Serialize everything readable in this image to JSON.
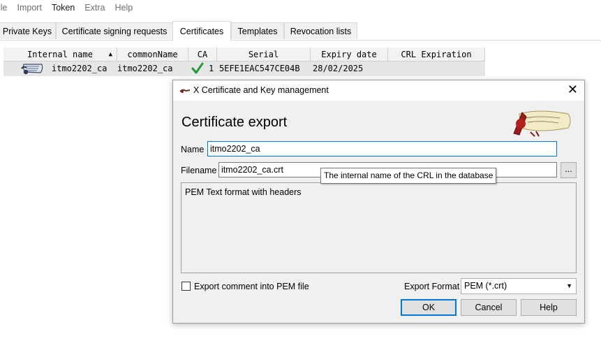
{
  "menu": {
    "file": "ile",
    "import": "Import",
    "token": "Token",
    "extra": "Extra",
    "help": "Help"
  },
  "tabs": [
    "Private Keys",
    "Certificate signing requests",
    "Certificates",
    "Templates",
    "Revocation lists"
  ],
  "list": {
    "headers": [
      "Internal name",
      "commonName",
      "CA",
      "Serial",
      "Expiry date",
      "CRL Expiration"
    ],
    "rows": [
      {
        "internal_name": "itmo2202_ca",
        "common_name": "itmo2202_ca",
        "ca": "1",
        "serial": "5EFE1EAC547CE04B",
        "expiry": "28/02/2025",
        "crl_expiration": ""
      }
    ],
    "icons": {
      "row_icon": "certificate-icon",
      "ca_icon": "checkmark-icon",
      "sort_icon": "sort-ascending-icon"
    },
    "colors": {
      "checkmark": "#1e9b34"
    }
  },
  "dialog": {
    "title": "X Certificate and Key management",
    "heading": "Certificate export",
    "name_label": "Name",
    "name_value": "itmo2202_ca",
    "filename_label": "Filename",
    "filename_value": "itmo2202_ca.crt",
    "browse_label": "...",
    "description": "PEM Text format with headers",
    "checkbox_label": "Export comment into PEM file",
    "checkbox_checked": false,
    "format_label": "Export Format",
    "format_value": "PEM (*.crt)",
    "ok_label": "OK",
    "cancel_label": "Cancel",
    "help_label": "Help",
    "colors": {
      "accent": "#0078d7"
    }
  },
  "tooltip": {
    "text": "The internal name of the CRL in the database"
  }
}
